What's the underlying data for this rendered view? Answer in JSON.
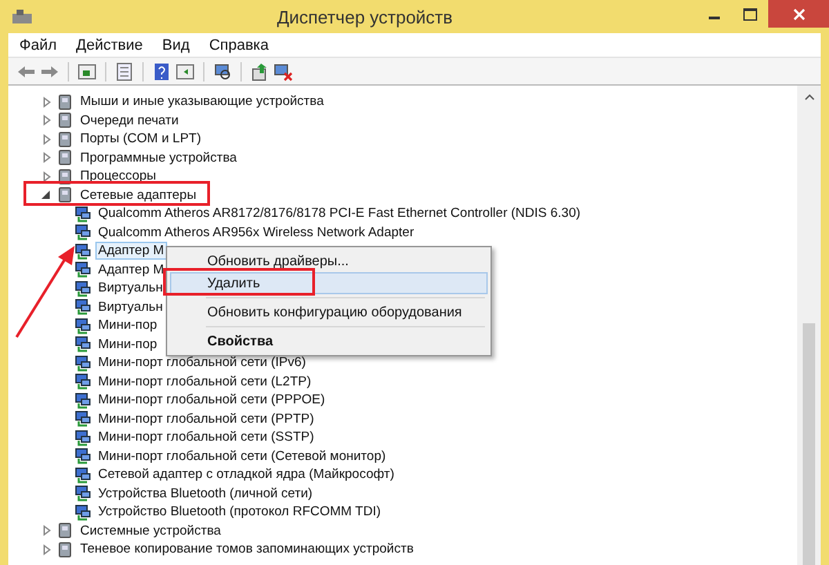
{
  "window": {
    "title": "Диспетчер устройств"
  },
  "menu": [
    "Файл",
    "Действие",
    "Вид",
    "Справка"
  ],
  "tree": [
    {
      "label": "Мыши и иные указывающие устройства",
      "expanded": false
    },
    {
      "label": "Очереди печати",
      "expanded": false
    },
    {
      "label": "Порты (COM и LPT)",
      "expanded": false
    },
    {
      "label": "Программные устройства",
      "expanded": false
    },
    {
      "label": "Процессоры",
      "expanded": false
    },
    {
      "label": "Сетевые адаптеры",
      "expanded": true,
      "children": [
        {
          "label": "Qualcomm Atheros AR8172/8176/8178 PCI-E Fast Ethernet Controller (NDIS 6.30)",
          "selected": false
        },
        {
          "label": "Qualcomm Atheros AR956x Wireless Network Adapter",
          "selected": false
        },
        {
          "label": "Адаптер M",
          "selected": true
        },
        {
          "label": "Адаптер M",
          "selected": false
        },
        {
          "label": "Виртуальн",
          "selected": false
        },
        {
          "label": "Виртуальн",
          "selected": false
        },
        {
          "label": "Мини-пор",
          "selected": false
        },
        {
          "label": "Мини-пор",
          "selected": false
        },
        {
          "label": "Мини-порт глобальной сети (IPv6)",
          "selected": false
        },
        {
          "label": "Мини-порт глобальной сети (L2TP)",
          "selected": false
        },
        {
          "label": "Мини-порт глобальной сети (PPPOE)",
          "selected": false
        },
        {
          "label": "Мини-порт глобальной сети (PPTP)",
          "selected": false
        },
        {
          "label": "Мини-порт глобальной сети (SSTP)",
          "selected": false
        },
        {
          "label": "Мини-порт глобальной сети (Сетевой монитор)",
          "selected": false
        },
        {
          "label": "Сетевой адаптер с отладкой ядра (Майкрософт)",
          "selected": false
        },
        {
          "label": "Устройства Bluetooth (личной сети)",
          "selected": false
        },
        {
          "label": "Устройство Bluetooth (протокол RFCOMM TDI)",
          "selected": false
        }
      ]
    },
    {
      "label": "Системные устройства",
      "expanded": false
    },
    {
      "label": "Теневое копирование томов запоминающих устройств",
      "expanded": false
    }
  ],
  "context_menu": [
    {
      "label": "Обновить драйверы...",
      "selected": false,
      "bold": false
    },
    {
      "label": "Удалить",
      "selected": true,
      "bold": false
    },
    {
      "label": "Обновить конфигурацию оборудования",
      "selected": false,
      "bold": false
    },
    {
      "label": "Свойства",
      "selected": false,
      "bold": true
    }
  ]
}
